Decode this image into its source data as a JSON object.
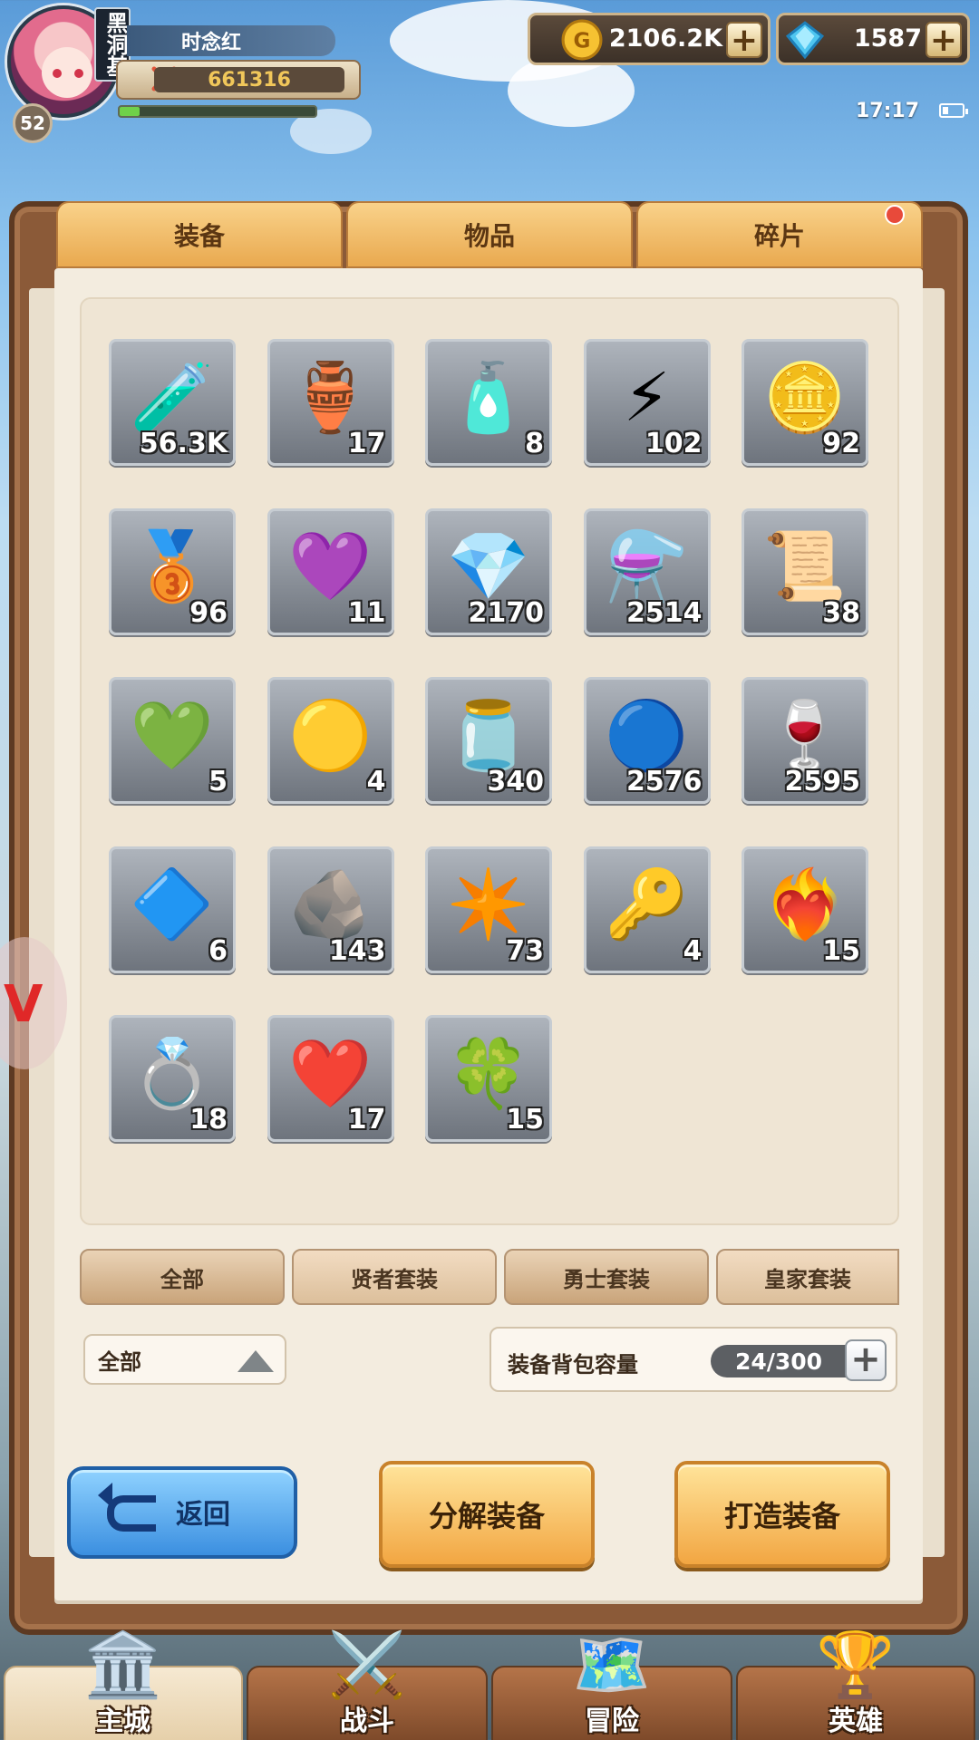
{
  "player": {
    "name": "时念红",
    "level": "52",
    "vip_tag": "黑洞基",
    "power": "661316",
    "exp_fraction": 0.1
  },
  "currency": {
    "gold": "2106.2K",
    "gems": "1587",
    "plus": "+"
  },
  "status": {
    "time": "17:17"
  },
  "tabs": [
    {
      "label": "装备"
    },
    {
      "label": "物品"
    },
    {
      "label": "碎片"
    }
  ],
  "items": [
    {
      "icon": "green-potion-icon",
      "glyph": "🧪",
      "count": "56.3K"
    },
    {
      "icon": "blue-amphora-icon",
      "glyph": "🏺",
      "count": "17"
    },
    {
      "icon": "orange-vial-icon",
      "glyph": "🧴",
      "count": "8"
    },
    {
      "icon": "lightning-rune-icon",
      "glyph": "⚡",
      "count": "102"
    },
    {
      "icon": "silver-coin-icon",
      "glyph": "🪙",
      "count": "92"
    },
    {
      "icon": "bronze-sword-medal-icon",
      "glyph": "🥉",
      "count": "96"
    },
    {
      "icon": "purple-helmet-gem-icon",
      "glyph": "💜",
      "count": "11"
    },
    {
      "icon": "blue-crystals-icon",
      "glyph": "💎",
      "count": "2170"
    },
    {
      "icon": "purple-flask-icon",
      "glyph": "⚗️",
      "count": "2514"
    },
    {
      "icon": "helmet-scroll-icon",
      "glyph": "📜",
      "count": "38"
    },
    {
      "icon": "green-glove-gem-icon",
      "glyph": "💚",
      "count": "5"
    },
    {
      "icon": "gold-armor-gem-icon",
      "glyph": "🟡",
      "count": "4"
    },
    {
      "icon": "purple-jar-icon",
      "glyph": "🫙",
      "count": "340"
    },
    {
      "icon": "blue-orb-icon",
      "glyph": "🔵",
      "count": "2576"
    },
    {
      "icon": "red-potion-icon",
      "glyph": "🍷",
      "count": "2595"
    },
    {
      "icon": "boot-gem-icon",
      "glyph": "🔷",
      "count": "6"
    },
    {
      "icon": "ore-rock-icon",
      "glyph": "🪨",
      "count": "143"
    },
    {
      "icon": "red-star-shard-icon",
      "glyph": "✴️",
      "count": "73"
    },
    {
      "icon": "silver-key-icon",
      "glyph": "🔑",
      "count": "4"
    },
    {
      "icon": "red-sword-gem-icon",
      "glyph": "❤️‍🔥",
      "count": "15"
    },
    {
      "icon": "blue-ring-gem-icon",
      "glyph": "💍",
      "count": "18"
    },
    {
      "icon": "red-heart-icon",
      "glyph": "❤️",
      "count": "17"
    },
    {
      "icon": "four-leaf-clover-icon",
      "glyph": "🍀",
      "count": "15"
    }
  ],
  "filters": [
    {
      "label": "全部"
    },
    {
      "label": "贤者套装"
    },
    {
      "label": "勇士套装"
    },
    {
      "label": "皇家套装"
    }
  ],
  "select": {
    "value": "全部"
  },
  "capacity": {
    "label": "装备背包容量",
    "used": 24,
    "max": 300,
    "text": "24/300"
  },
  "actions": {
    "back": "返回",
    "decompose": "分解装备",
    "forge": "打造装备"
  },
  "nav": [
    {
      "label": "主城",
      "icon": "castle-gate-icon",
      "glyph": "🏛️"
    },
    {
      "label": "战斗",
      "icon": "crossed-swords-icon",
      "glyph": "⚔️"
    },
    {
      "label": "冒险",
      "icon": "map-scroll-icon",
      "glyph": "🗺️"
    },
    {
      "label": "英雄",
      "icon": "hero-crest-icon",
      "glyph": "🏆"
    }
  ]
}
